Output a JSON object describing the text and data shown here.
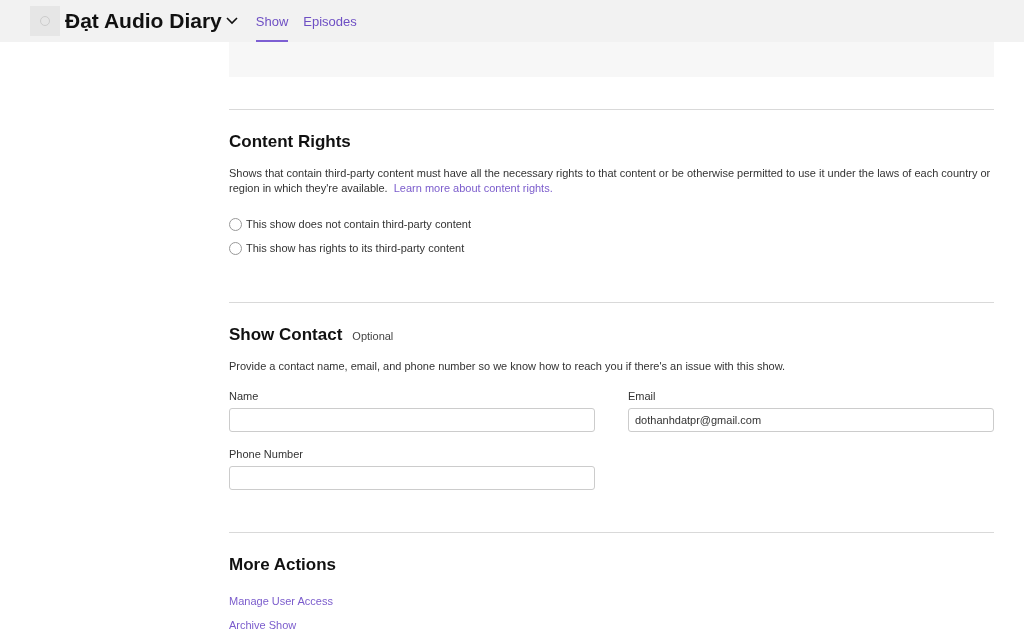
{
  "header": {
    "show_title": "Đạt Audio Diary",
    "tabs": [
      {
        "label": "Show",
        "selected": true
      },
      {
        "label": "Episodes",
        "selected": false
      }
    ]
  },
  "content_rights": {
    "heading": "Content Rights",
    "description": "Shows that contain third-party content must have all the necessary rights to that content or be otherwise permitted to use it under the laws of each country or region in which they're available.",
    "link": "Learn more about content rights.",
    "options": [
      {
        "label": "This show does not contain third-party content",
        "selected": false
      },
      {
        "label": "This show has rights to its third-party content",
        "selected": false
      }
    ]
  },
  "show_contact": {
    "heading": "Show Contact",
    "badge": "Optional",
    "description": "Provide a contact name, email, and phone number so we know how to reach you if there's an issue with this show.",
    "fields": [
      {
        "label": "Name"
      },
      {
        "label": "Email",
        "value": "dothanhdatpr@gmail.com"
      },
      {
        "label": "Phone Number"
      }
    ]
  },
  "more_actions": {
    "heading": "More Actions",
    "links": [
      "Manage User Access",
      "Archive Show"
    ]
  }
}
